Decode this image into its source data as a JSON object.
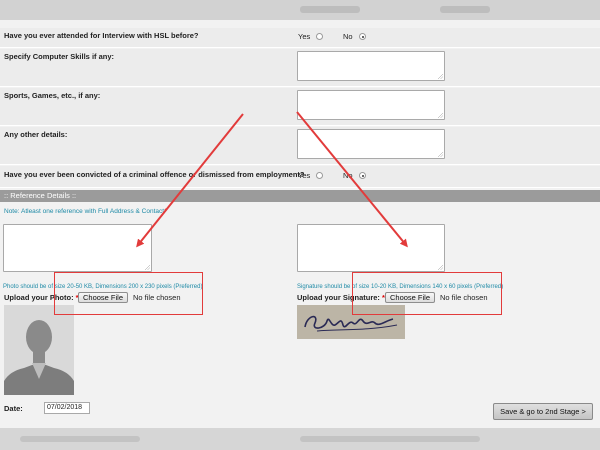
{
  "form": {
    "q_interview": "Have you ever attended for Interview with HSL before?",
    "q_interview_yes": "Yes",
    "q_interview_no": "No",
    "q_interview_selected": "No",
    "q_computer_skills": "Specify Computer Skills if any:",
    "q_sports": "Sports, Games, etc., if any:",
    "q_other": "Any other details:",
    "q_convicted": "Have you ever been convicted of a criminal offence or dismissed from employment?",
    "q_convicted_yes": "Yes",
    "q_convicted_no": "No",
    "q_convicted_selected": "No"
  },
  "reference": {
    "section_title": ":: Reference Details ::",
    "note": "Note: Atleast one reference with Full Address & Contact",
    "required_mark": "*"
  },
  "upload": {
    "photo_hint": "Photo should be of size 20-50 KB, Dimensions 200 x 230 pixels (Preferred)",
    "photo_label": "Upload your Photo:",
    "signature_hint": "Signature should be of size 10-20 KB, Dimensions 140 x 60 pixels (Preferred)",
    "signature_label": "Upload your Signature:",
    "required_mark": "*",
    "choose_file": "Choose File",
    "no_file": "No file chosen"
  },
  "footer": {
    "date_label": "Date:",
    "date_value": "07/02/2018",
    "submit_label": "Save & go to 2nd Stage >"
  },
  "annotation": {
    "color": "#e23b3b"
  },
  "signature_image": {
    "text": "Signature"
  }
}
